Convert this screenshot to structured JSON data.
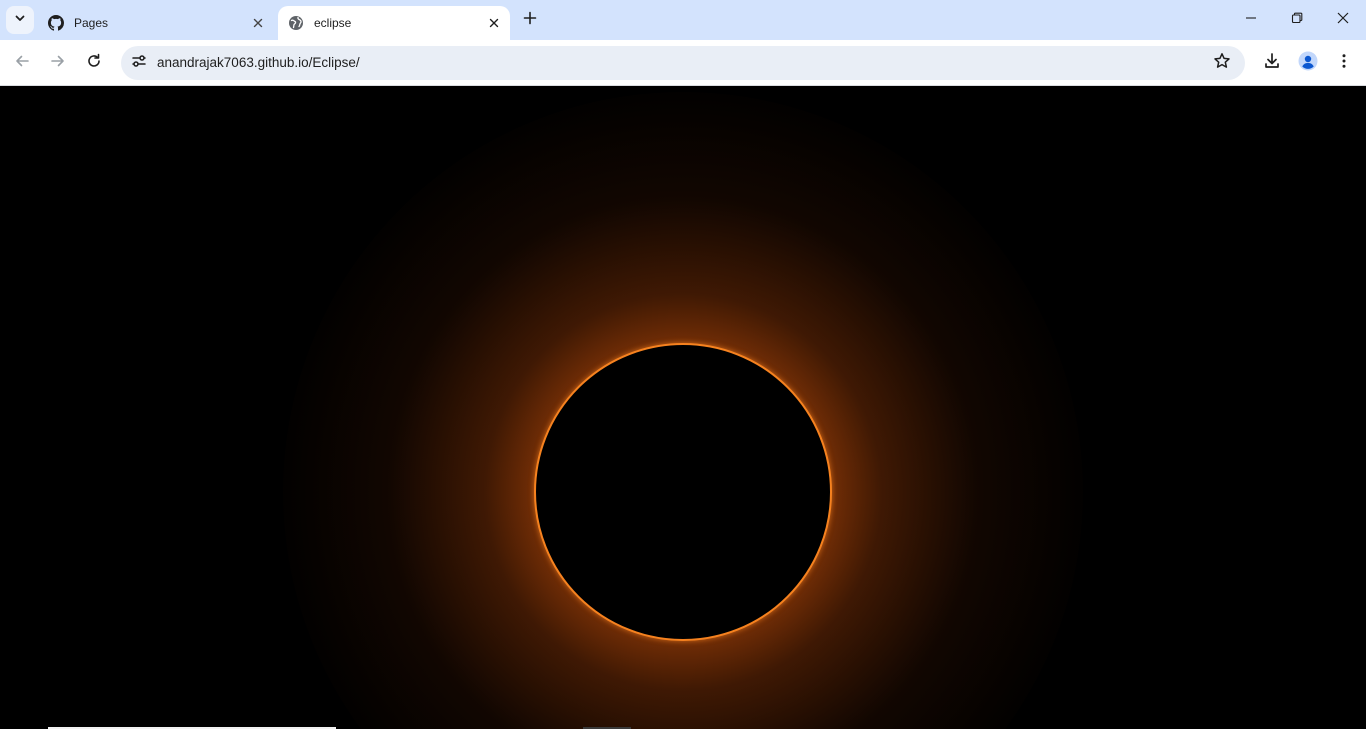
{
  "browser": {
    "tabs": [
      {
        "title": "Pages",
        "icon": "github-icon",
        "active": false
      },
      {
        "title": "eclipse",
        "icon": "globe-icon",
        "active": true
      }
    ],
    "url": "anandrajak7063.github.io/Eclipse/"
  },
  "page": {
    "background_color": "#000000",
    "ring_color": "#f6821f",
    "glow_color": "#e06414"
  }
}
